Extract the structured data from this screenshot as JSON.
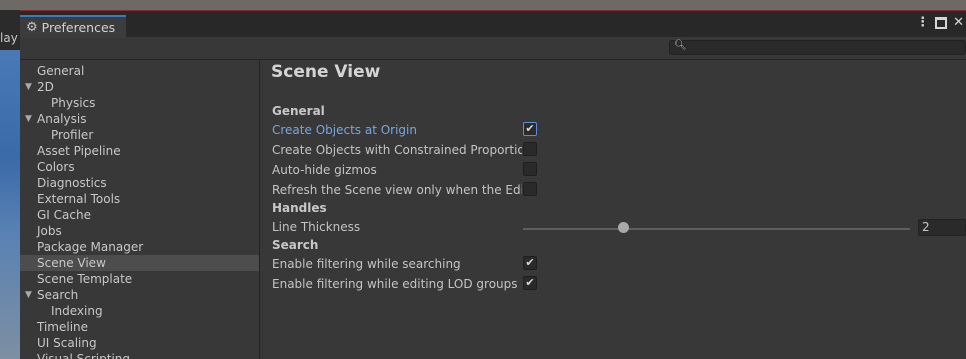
{
  "background": {
    "play_text": "lay"
  },
  "window": {
    "tab_title": "Preferences",
    "tab_icon": "gear-icon",
    "controls": [
      "more-options-icon",
      "maximize-icon",
      "close-icon"
    ],
    "accent_color": "#3a79bb"
  },
  "search": {
    "icon": "search-icon",
    "value": ""
  },
  "sidebar": {
    "items": [
      {
        "label": "General",
        "indent": 0,
        "expandable": false
      },
      {
        "label": "2D",
        "indent": 0,
        "expandable": true
      },
      {
        "label": "Physics",
        "indent": 1,
        "expandable": false
      },
      {
        "label": "Analysis",
        "indent": 0,
        "expandable": true
      },
      {
        "label": "Profiler",
        "indent": 1,
        "expandable": false
      },
      {
        "label": "Asset Pipeline",
        "indent": 0,
        "expandable": false
      },
      {
        "label": "Colors",
        "indent": 0,
        "expandable": false
      },
      {
        "label": "Diagnostics",
        "indent": 0,
        "expandable": false
      },
      {
        "label": "External Tools",
        "indent": 0,
        "expandable": false
      },
      {
        "label": "GI Cache",
        "indent": 0,
        "expandable": false
      },
      {
        "label": "Jobs",
        "indent": 0,
        "expandable": false
      },
      {
        "label": "Package Manager",
        "indent": 0,
        "expandable": false
      },
      {
        "label": "Scene View",
        "indent": 0,
        "expandable": false,
        "selected": true
      },
      {
        "label": "Scene Template",
        "indent": 0,
        "expandable": false
      },
      {
        "label": "Search",
        "indent": 0,
        "expandable": true
      },
      {
        "label": "Indexing",
        "indent": 1,
        "expandable": false
      },
      {
        "label": "Timeline",
        "indent": 0,
        "expandable": false
      },
      {
        "label": "UI Scaling",
        "indent": 0,
        "expandable": false
      },
      {
        "label": "Visual Scripting",
        "indent": 0,
        "expandable": false
      }
    ]
  },
  "main": {
    "title": "Scene View",
    "general": {
      "heading": "General",
      "rows": [
        {
          "label": "Create Objects at Origin",
          "checked": true
        },
        {
          "label": "Create Objects with Constrained Proportions",
          "checked": false
        },
        {
          "label": "Auto-hide gizmos",
          "checked": false
        },
        {
          "label": "Refresh the Scene view only when the Editor is in focus",
          "checked": false
        }
      ]
    },
    "handles": {
      "heading": "Handles",
      "line_thickness_label": "Line Thickness",
      "line_thickness_value": "2"
    },
    "search": {
      "heading": "Search",
      "rows": [
        {
          "label": "Enable filtering while searching",
          "checked": true
        },
        {
          "label": "Enable filtering while editing LOD groups",
          "checked": true
        }
      ]
    }
  }
}
